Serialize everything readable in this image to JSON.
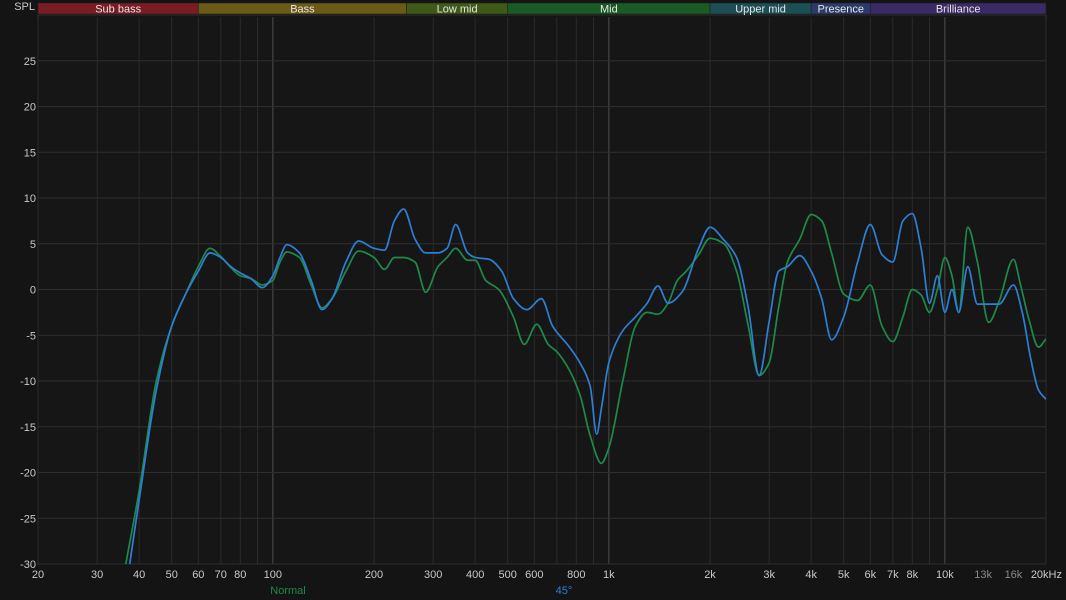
{
  "chart_data": {
    "type": "line",
    "ylabel": "SPL",
    "xscale": "log",
    "xlim": [
      20,
      20000
    ],
    "ylim": [
      -30,
      30
    ],
    "grid": true,
    "legend_position": "bottom-center",
    "y_ticks": [
      25,
      20,
      15,
      10,
      5,
      0,
      -5,
      -10,
      -15,
      -20,
      -25,
      -30
    ],
    "x_ticks": [
      {
        "value": 20,
        "label": "20",
        "dim": false
      },
      {
        "value": 30,
        "label": "30",
        "dim": false
      },
      {
        "value": 40,
        "label": "40",
        "dim": false
      },
      {
        "value": 50,
        "label": "50",
        "dim": false
      },
      {
        "value": 60,
        "label": "60",
        "dim": false
      },
      {
        "value": 70,
        "label": "70",
        "dim": false
      },
      {
        "value": 80,
        "label": "80",
        "dim": false
      },
      {
        "value": 100,
        "label": "100",
        "dim": false
      },
      {
        "value": 200,
        "label": "200",
        "dim": false
      },
      {
        "value": 300,
        "label": "300",
        "dim": false
      },
      {
        "value": 400,
        "label": "400",
        "dim": false
      },
      {
        "value": 500,
        "label": "500",
        "dim": false
      },
      {
        "value": 600,
        "label": "600",
        "dim": false
      },
      {
        "value": 800,
        "label": "800",
        "dim": false
      },
      {
        "value": 1000,
        "label": "1k",
        "dim": false
      },
      {
        "value": 2000,
        "label": "2k",
        "dim": false
      },
      {
        "value": 3000,
        "label": "3k",
        "dim": false
      },
      {
        "value": 4000,
        "label": "4k",
        "dim": false
      },
      {
        "value": 5000,
        "label": "5k",
        "dim": false
      },
      {
        "value": 6000,
        "label": "6k",
        "dim": false
      },
      {
        "value": 7000,
        "label": "7k",
        "dim": false
      },
      {
        "value": 8000,
        "label": "8k",
        "dim": false
      },
      {
        "value": 10000,
        "label": "10k",
        "dim": false
      },
      {
        "value": 13000,
        "label": "13k",
        "dim": true
      },
      {
        "value": 16000,
        "label": "16k",
        "dim": true
      },
      {
        "value": 20000,
        "label": "20kHz",
        "dim": false
      }
    ],
    "bands": [
      {
        "name": "Sub bass",
        "from": 20,
        "to": 60,
        "color": "#7a1c24"
      },
      {
        "name": "Bass",
        "from": 60,
        "to": 250,
        "color": "#6b5a16"
      },
      {
        "name": "Low mid",
        "from": 250,
        "to": 500,
        "color": "#3f5a16"
      },
      {
        "name": "Mid",
        "from": 500,
        "to": 2000,
        "color": "#1a5a24"
      },
      {
        "name": "Upper mid",
        "from": 2000,
        "to": 4000,
        "color": "#1c4f55"
      },
      {
        "name": "Presence",
        "from": 4000,
        "to": 6000,
        "color": "#2a3a6a"
      },
      {
        "name": "Brilliance",
        "from": 6000,
        "to": 20000,
        "color": "#3a2a66"
      }
    ],
    "series": [
      {
        "name": "Normal",
        "color": "#1e8a4a",
        "points": [
          [
            36.5,
            -30
          ],
          [
            40,
            -22
          ],
          [
            45,
            -10
          ],
          [
            50,
            -4
          ],
          [
            55,
            -0.5
          ],
          [
            60,
            2.5
          ],
          [
            65,
            4.5
          ],
          [
            70,
            3.6
          ],
          [
            75,
            2.4
          ],
          [
            80,
            1.5
          ],
          [
            86,
            1.2
          ],
          [
            93,
            0.5
          ],
          [
            100,
            1
          ],
          [
            105,
            3
          ],
          [
            110,
            4.1
          ],
          [
            120,
            3.5
          ],
          [
            130,
            0.5
          ],
          [
            140,
            -2
          ],
          [
            150,
            -1
          ],
          [
            165,
            2
          ],
          [
            180,
            4.2
          ],
          [
            200,
            3.5
          ],
          [
            215,
            2.2
          ],
          [
            230,
            3.5
          ],
          [
            245,
            3.5
          ],
          [
            265,
            3
          ],
          [
            285,
            -0.3
          ],
          [
            310,
            2.5
          ],
          [
            330,
            3.5
          ],
          [
            350,
            4.5
          ],
          [
            380,
            3.2
          ],
          [
            400,
            3.2
          ],
          [
            430,
            1
          ],
          [
            470,
            0
          ],
          [
            520,
            -3
          ],
          [
            560,
            -6
          ],
          [
            610,
            -3.8
          ],
          [
            660,
            -6
          ],
          [
            700,
            -6.8
          ],
          [
            760,
            -8.7
          ],
          [
            820,
            -11.5
          ],
          [
            880,
            -16
          ],
          [
            950,
            -19
          ],
          [
            1000,
            -17.3
          ],
          [
            1100,
            -10
          ],
          [
            1200,
            -4
          ],
          [
            1300,
            -2.5
          ],
          [
            1400,
            -2.7
          ],
          [
            1500,
            -1.5
          ],
          [
            1600,
            1
          ],
          [
            1700,
            2
          ],
          [
            1850,
            3.8
          ],
          [
            2000,
            5.6
          ],
          [
            2200,
            5
          ],
          [
            2400,
            2
          ],
          [
            2600,
            -4
          ],
          [
            2800,
            -9.4
          ],
          [
            3000,
            -8
          ],
          [
            3200,
            -2
          ],
          [
            3400,
            3
          ],
          [
            3700,
            5.5
          ],
          [
            4000,
            8.2
          ],
          [
            4300,
            7.5
          ],
          [
            4600,
            4
          ],
          [
            5000,
            -0.5
          ],
          [
            5500,
            -1.2
          ],
          [
            6000,
            0.5
          ],
          [
            6500,
            -4
          ],
          [
            7000,
            -5.7
          ],
          [
            7500,
            -3
          ],
          [
            8000,
            0
          ],
          [
            8500,
            -0.6
          ],
          [
            9000,
            -2.5
          ],
          [
            9500,
            0
          ],
          [
            10000,
            3.5
          ],
          [
            10500,
            1.5
          ],
          [
            11000,
            -2.5
          ],
          [
            11700,
            6.8
          ],
          [
            12500,
            3
          ],
          [
            13500,
            -3.6
          ],
          [
            14500,
            -1.3
          ],
          [
            16000,
            3.3
          ],
          [
            16800,
            0.5
          ],
          [
            17800,
            -3.3
          ],
          [
            19000,
            -6.3
          ],
          [
            20000,
            -5.4
          ]
        ]
      },
      {
        "name": "45°",
        "color": "#2d7fd6",
        "points": [
          [
            37.5,
            -30
          ],
          [
            40,
            -23
          ],
          [
            45,
            -11
          ],
          [
            50,
            -4
          ],
          [
            55,
            -0.5
          ],
          [
            60,
            2
          ],
          [
            65,
            4
          ],
          [
            70,
            3.5
          ],
          [
            75,
            2.5
          ],
          [
            80,
            1.8
          ],
          [
            86,
            1.2
          ],
          [
            93,
            0.2
          ],
          [
            100,
            1.5
          ],
          [
            105,
            3.5
          ],
          [
            110,
            4.9
          ],
          [
            120,
            4
          ],
          [
            130,
            1
          ],
          [
            140,
            -2.2
          ],
          [
            150,
            -1
          ],
          [
            165,
            3
          ],
          [
            180,
            5.3
          ],
          [
            200,
            4.5
          ],
          [
            215,
            4.3
          ],
          [
            230,
            7.5
          ],
          [
            245,
            8.8
          ],
          [
            265,
            5.5
          ],
          [
            285,
            4
          ],
          [
            310,
            4
          ],
          [
            330,
            4.5
          ],
          [
            350,
            7.1
          ],
          [
            380,
            4
          ],
          [
            400,
            3.5
          ],
          [
            440,
            3.3
          ],
          [
            480,
            2
          ],
          [
            520,
            -1
          ],
          [
            570,
            -2.2
          ],
          [
            630,
            -1
          ],
          [
            680,
            -4
          ],
          [
            760,
            -6.2
          ],
          [
            820,
            -8
          ],
          [
            880,
            -10.6
          ],
          [
            920,
            -15.8
          ],
          [
            950,
            -13
          ],
          [
            1000,
            -8
          ],
          [
            1100,
            -4.5
          ],
          [
            1200,
            -3
          ],
          [
            1300,
            -1.5
          ],
          [
            1400,
            0.4
          ],
          [
            1500,
            -1.5
          ],
          [
            1650,
            -0.3
          ],
          [
            1850,
            4.5
          ],
          [
            2000,
            6.8
          ],
          [
            2200,
            5.4
          ],
          [
            2400,
            3.5
          ],
          [
            2600,
            -2
          ],
          [
            2800,
            -9.4
          ],
          [
            3000,
            -3.5
          ],
          [
            3200,
            2
          ],
          [
            3400,
            2.5
          ],
          [
            3700,
            3.7
          ],
          [
            4000,
            2
          ],
          [
            4300,
            -1
          ],
          [
            4600,
            -5.5
          ],
          [
            5000,
            -3
          ],
          [
            5500,
            3
          ],
          [
            6000,
            7.1
          ],
          [
            6500,
            3.8
          ],
          [
            7000,
            3
          ],
          [
            7500,
            7.5
          ],
          [
            8000,
            8.3
          ],
          [
            8500,
            4.5
          ],
          [
            9000,
            -1.5
          ],
          [
            9500,
            1.5
          ],
          [
            10000,
            -2.5
          ],
          [
            10500,
            0
          ],
          [
            11000,
            -2.5
          ],
          [
            11700,
            2.5
          ],
          [
            12500,
            -1.6
          ],
          [
            13500,
            -1.6
          ],
          [
            14500,
            -1.6
          ],
          [
            16000,
            0.5
          ],
          [
            17000,
            -2.5
          ],
          [
            18000,
            -7.5
          ],
          [
            19000,
            -11
          ],
          [
            20000,
            -12
          ]
        ]
      }
    ]
  }
}
